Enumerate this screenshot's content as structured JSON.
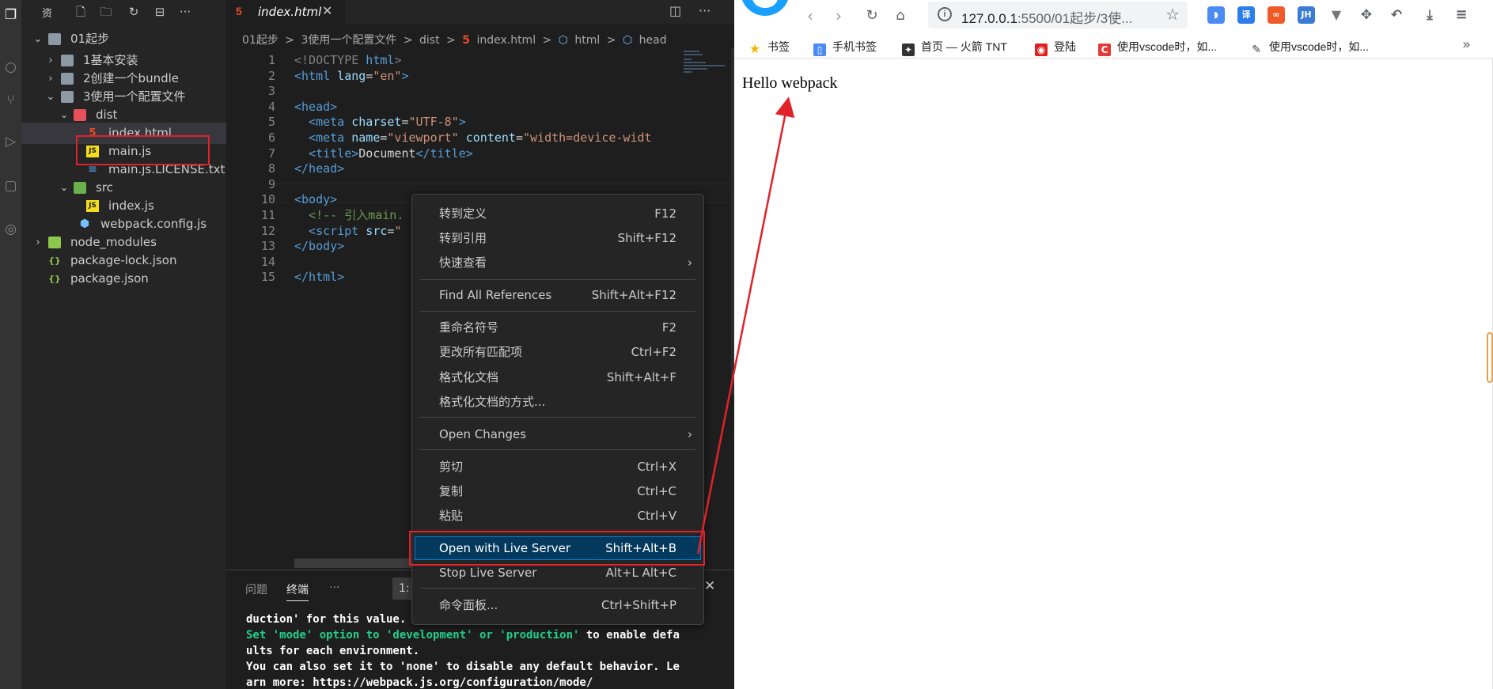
{
  "explorer": {
    "title": "资",
    "tree": [
      {
        "label": "01起步"
      },
      {
        "label": "1基本安装"
      },
      {
        "label": "2创建一个bundle"
      },
      {
        "label": "3使用一个配置文件"
      },
      {
        "label": "dist"
      },
      {
        "label": "index.html"
      },
      {
        "label": "main.js"
      },
      {
        "label": "main.js.LICENSE.txt"
      },
      {
        "label": "src"
      },
      {
        "label": "index.js"
      },
      {
        "label": "webpack.config.js"
      },
      {
        "label": "node_modules"
      },
      {
        "label": "package-lock.json"
      },
      {
        "label": "package.json"
      }
    ]
  },
  "editor": {
    "tab_label": "index.html",
    "breadcrumb": [
      "01起步",
      ">",
      "3使用一个配置文件",
      ">",
      "dist",
      ">",
      "index.html",
      ">",
      "html",
      ">",
      "head"
    ],
    "line_numbers": [
      "1",
      "2",
      "3",
      "4",
      "5",
      "6",
      "7",
      "8",
      "9",
      "10",
      "11",
      "12",
      "13",
      "14",
      "15"
    ],
    "code": {
      "l1_open": "<!DOCTYPE",
      "l1_name": " html",
      "l1_close": ">",
      "l2_tag": "<html",
      "l2_attr": " lang",
      "l2_eq": "=",
      "l2_val": "\"en\"",
      "l2_close": ">",
      "l4": "<head>",
      "l5_tag": "  <meta",
      "l5_attr": " charset",
      "l5_eq": "=",
      "l5_val": "\"UTF-8\"",
      "l5_close": ">",
      "l6_tag": "  <meta",
      "l6_attr1": " name",
      "l6_eq1": "=",
      "l6_val1": "\"viewport\"",
      "l6_attr2": " content",
      "l6_eq2": "=",
      "l6_val2": "\"width=device-widt",
      "l7_open": "  <title>",
      "l7_text": "Document",
      "l7_close": "</title>",
      "l8": "</head>",
      "l10": "<body>",
      "l11": "  <!-- 引入main.",
      "l12_tag": "  <script",
      "l12_attr": " src",
      "l12_eq": "=",
      "l12_val": "\"",
      "l13": "</body>",
      "l15": "</html>"
    }
  },
  "panel": {
    "tabs": [
      "问题",
      "终端",
      "···"
    ],
    "dropdown": "1:",
    "terminal_lines": [
      {
        "text": "duction' for this value."
      },
      {
        "green": "Set 'mode' option to 'development' or 'production'",
        "rest": " to enable defa"
      },
      {
        "text": "ults for each environment."
      },
      {
        "text": "You can also set it to 'none' to disable any default behavior. Le"
      },
      {
        "text": "arn more: https://webpack.js.org/configuration/mode/"
      }
    ]
  },
  "context_menu": {
    "items": [
      {
        "label": "转到定义",
        "shortcut": "F12"
      },
      {
        "label": "转到引用",
        "shortcut": "Shift+F12"
      },
      {
        "label": "快速查看",
        "shortcut": "",
        "submenu": true
      },
      {
        "label": "Find All References",
        "shortcut": "Shift+Alt+F12"
      },
      {
        "label": "重命名符号",
        "shortcut": "F2"
      },
      {
        "label": "更改所有匹配项",
        "shortcut": "Ctrl+F2"
      },
      {
        "label": "格式化文档",
        "shortcut": "Shift+Alt+F"
      },
      {
        "label": "格式化文档的方式...",
        "shortcut": ""
      },
      {
        "label": "Open Changes",
        "shortcut": "",
        "submenu": true
      },
      {
        "label": "剪切",
        "shortcut": "Ctrl+X"
      },
      {
        "label": "复制",
        "shortcut": "Ctrl+C"
      },
      {
        "label": "粘贴",
        "shortcut": "Ctrl+V"
      },
      {
        "label": "Open with Live Server",
        "shortcut": "Shift+Alt+B",
        "highlighted": true
      },
      {
        "label": "Stop Live Server",
        "shortcut": "Alt+L Alt+C"
      },
      {
        "label": "命令面板...",
        "shortcut": "Ctrl+Shift+P"
      }
    ]
  },
  "browser": {
    "url_host": "127.0.0.1",
    "url_rest": ":5500/01起步/3使...",
    "ext_labels": [
      "译",
      "JH"
    ],
    "bookmarks": [
      "书签",
      "手机书签",
      "首页 — 火箭 TNT",
      "登陆",
      "使用vscode时，如...",
      "使用vscode时，如..."
    ],
    "page_text": "Hello webpack"
  },
  "colors": {
    "highlight_red": "#e0222a",
    "menu_highlight": "#04395e",
    "browser_accent": "#19a0ff"
  }
}
